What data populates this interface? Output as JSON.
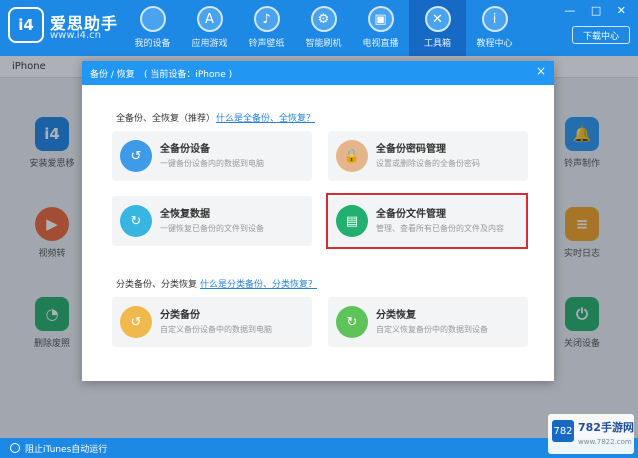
{
  "header": {
    "logo_text": "i4",
    "brand": "爱思助手",
    "url": "www.i4.cn",
    "nav": [
      {
        "label": "我的设备",
        "icon": "apple-icon",
        "glyph": ""
      },
      {
        "label": "应用游戏",
        "icon": "app-store-icon",
        "glyph": "A"
      },
      {
        "label": "铃声壁纸",
        "icon": "bell-icon",
        "glyph": "♪"
      },
      {
        "label": "智能刷机",
        "icon": "gear-icon",
        "glyph": "⚙"
      },
      {
        "label": "电视直播",
        "icon": "tv-icon",
        "glyph": "▣"
      },
      {
        "label": "工具箱",
        "icon": "tools-icon",
        "glyph": "✕"
      },
      {
        "label": "教程中心",
        "icon": "info-icon",
        "glyph": "i"
      }
    ],
    "window_controls": "— □ ✕",
    "download_label": "下载中心"
  },
  "device_tab": "iPhone",
  "bg_apps": [
    {
      "label": "安装爱思移",
      "glyph": "i4",
      "color": "#1e88e5"
    },
    {
      "label": "视频转",
      "glyph": "▶",
      "color": "#f0673a"
    },
    {
      "label": "删除废照",
      "glyph": "◔",
      "color": "#27b36a"
    },
    {
      "label": "铃声制作",
      "glyph": "🔔",
      "color": "#2b9af3"
    },
    {
      "label": "实时日志",
      "glyph": "≡",
      "color": "#f5a623"
    },
    {
      "label": "关闭设备",
      "glyph": "⏻",
      "color": "#27b36a"
    }
  ],
  "modal": {
    "title": "备份 / 恢复",
    "device": "( 当前设备：iPhone )",
    "close": "×",
    "section1": {
      "title": "全备份、全恢复（推荐）",
      "link": "什么是全备份、全恢复？"
    },
    "section2": {
      "title": "分类备份、分类恢复",
      "link": "什么是分类备份、分类恢复？"
    },
    "cards": [
      {
        "title": "全备份设备",
        "desc": "一键备份设备内的数据到电脑",
        "color": "#3d9be9",
        "glyph": "↺"
      },
      {
        "title": "全备份密码管理",
        "desc": "设置或删除设备的全备份密码",
        "color": "#e4b48a",
        "glyph": "🔒"
      },
      {
        "title": "全恢复数据",
        "desc": "一键恢复已备份的文件到设备",
        "color": "#36b6e0",
        "glyph": "↻"
      },
      {
        "title": "全备份文件管理",
        "desc": "管理、查看所有已备份的文件及内容",
        "color": "#22b070",
        "glyph": "▤"
      },
      {
        "title": "分类备份",
        "desc": "自定义备份设备中的数据到电脑",
        "color": "#f1b94c",
        "glyph": "↺"
      },
      {
        "title": "分类恢复",
        "desc": "自定义恢复备份中的数据到设备",
        "color": "#5ec45a",
        "glyph": "↻"
      }
    ]
  },
  "status": {
    "text": "阻止iTunes自动运行"
  },
  "watermark": {
    "icon_text": "782",
    "text": "782手游网",
    "sub": "www.7822.com"
  }
}
